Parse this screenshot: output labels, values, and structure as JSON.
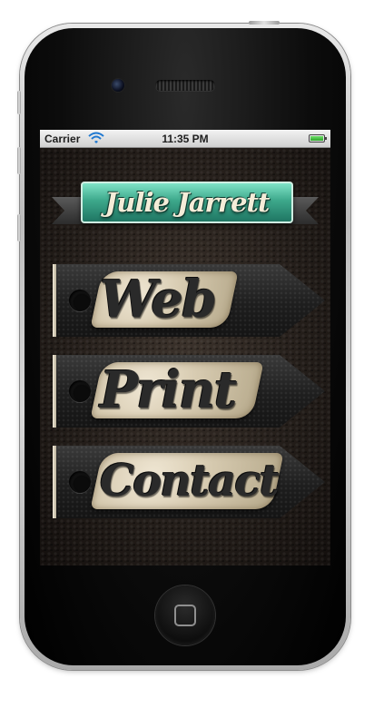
{
  "status_bar": {
    "carrier": "Carrier",
    "time": "11:35 PM",
    "wifi_icon": "wifi-icon",
    "battery_icon": "battery-icon"
  },
  "header": {
    "title": "Julie Jarrett"
  },
  "menu": {
    "items": [
      {
        "label": "Web"
      },
      {
        "label": "Print"
      },
      {
        "label": "Contact"
      }
    ]
  },
  "colors": {
    "name_plate": "#3da88b",
    "tag_body": "#1e1e1e",
    "label_plate": "#d8ccb2",
    "battery": "#2fa52b"
  }
}
